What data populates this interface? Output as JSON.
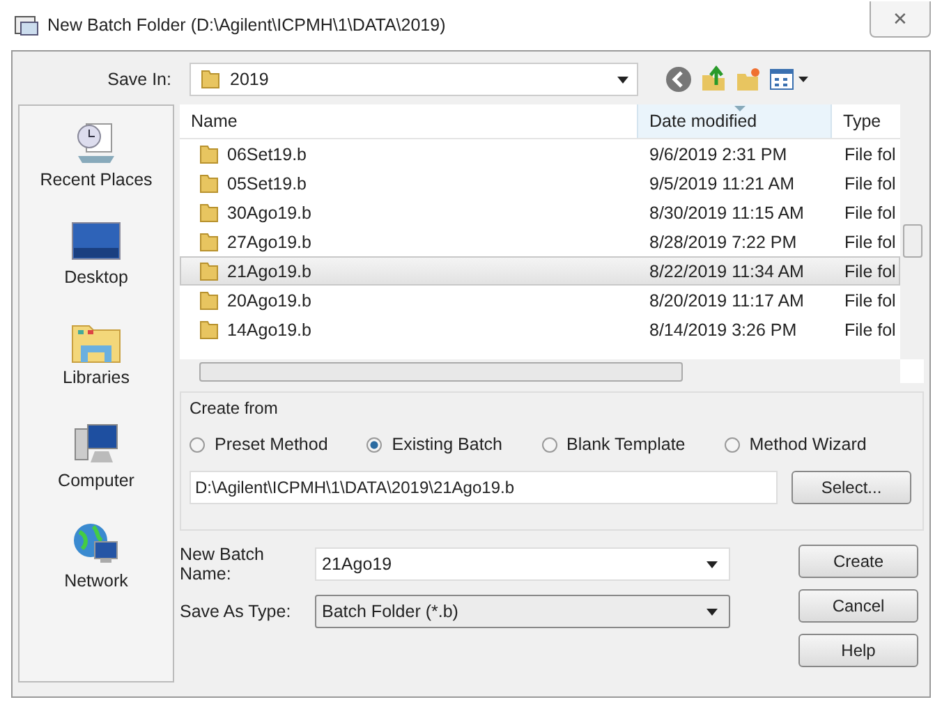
{
  "window": {
    "title": "New Batch Folder (D:\\Agilent\\ICPMH\\1\\DATA\\2019)",
    "close": "✕"
  },
  "save_in": {
    "label": "Save In:",
    "value": "2019"
  },
  "places": [
    {
      "label": "Recent Places",
      "kind": "recent"
    },
    {
      "label": "Desktop",
      "kind": "desktop"
    },
    {
      "label": "Libraries",
      "kind": "libraries"
    },
    {
      "label": "Computer",
      "kind": "computer"
    },
    {
      "label": "Network",
      "kind": "network"
    }
  ],
  "table": {
    "columns": [
      "Name",
      "Date modified",
      "Type"
    ],
    "rows": [
      {
        "name": "06Set19.b",
        "date": "9/6/2019 2:31 PM",
        "type": "File fol",
        "selected": false
      },
      {
        "name": "05Set19.b",
        "date": "9/5/2019 11:21 AM",
        "type": "File fol",
        "selected": false
      },
      {
        "name": "30Ago19.b",
        "date": "8/30/2019 11:15 AM",
        "type": "File fol",
        "selected": false
      },
      {
        "name": "27Ago19.b",
        "date": "8/28/2019 7:22 PM",
        "type": "File fol",
        "selected": false
      },
      {
        "name": "21Ago19.b",
        "date": "8/22/2019 11:34 AM",
        "type": "File fol",
        "selected": true
      },
      {
        "name": "20Ago19.b",
        "date": "8/20/2019 11:17 AM",
        "type": "File fol",
        "selected": false
      },
      {
        "name": "14Ago19.b",
        "date": "8/14/2019 3:26 PM",
        "type": "File fol",
        "selected": false
      }
    ]
  },
  "create_from": {
    "title": "Create from",
    "options": [
      {
        "label": "Preset Method",
        "selected": false
      },
      {
        "label": "Existing Batch",
        "selected": true
      },
      {
        "label": "Blank Template",
        "selected": false
      },
      {
        "label": "Method Wizard",
        "selected": false
      }
    ],
    "path": "D:\\Agilent\\ICPMH\\1\\DATA\\2019\\21Ago19.b",
    "select_button": "Select..."
  },
  "new_batch_name": {
    "label": "New Batch Name:",
    "value": "21Ago19"
  },
  "save_as_type": {
    "label": "Save As Type:",
    "value": "Batch Folder (*.b)"
  },
  "buttons": [
    "Create",
    "Cancel",
    "Help"
  ]
}
